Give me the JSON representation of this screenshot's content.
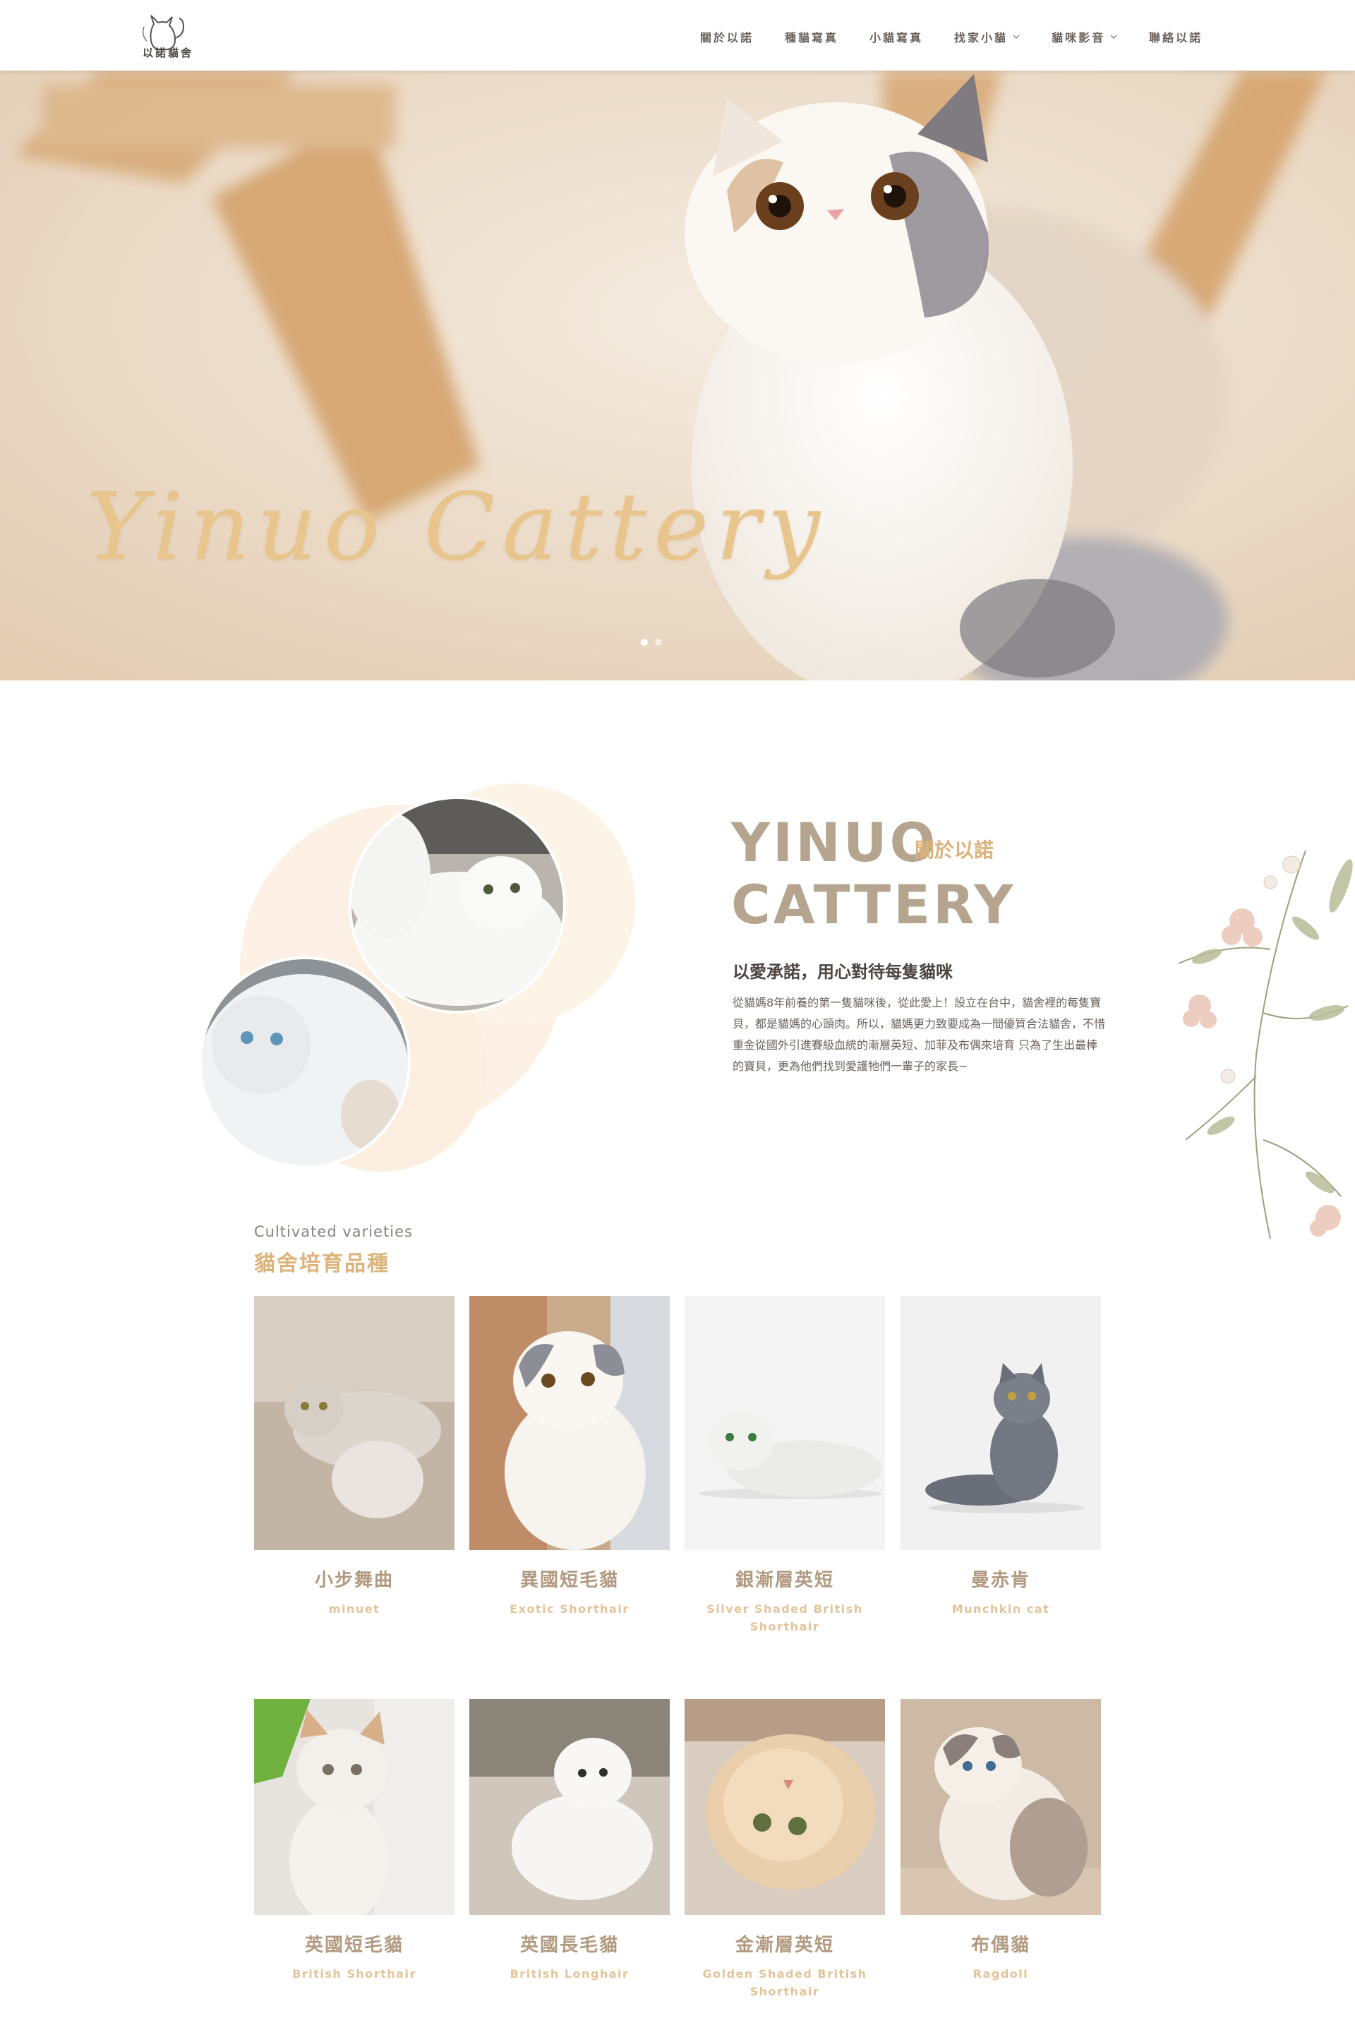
{
  "header": {
    "logo_text": "以諾貓舍",
    "nav": [
      {
        "label": "關於以諾",
        "has_dropdown": false
      },
      {
        "label": "種貓寫真",
        "has_dropdown": false
      },
      {
        "label": "小貓寫真",
        "has_dropdown": false
      },
      {
        "label": "找家小貓",
        "has_dropdown": true
      },
      {
        "label": "貓咪影音",
        "has_dropdown": true
      },
      {
        "label": "聯絡以諾",
        "has_dropdown": false
      }
    ]
  },
  "hero": {
    "title": "Yinuo Cattery",
    "slides_total": 2,
    "active_slide": 1
  },
  "about": {
    "heading_line1": "YINUO",
    "heading_line2": "CATTERY",
    "heading_zh": "關於以諾",
    "tagline": "以愛承諾，用心對待每隻貓咪",
    "body": "從貓媽8年前養的第一隻貓咪後，從此愛上！設立在台中，貓舍裡的每隻寶貝，都是貓媽的心頭肉。所以，貓媽更力致要成為一間優質合法貓舍，不惜重金從國外引進賽級血統的漸層英短、加菲及布偶來培育 只為了生出最棒的寶貝，更為他們找到愛護牠們一輩子的家長~"
  },
  "varieties": {
    "eyebrow": "Cultivated varieties",
    "title": "貓舍培育品種",
    "row1": [
      {
        "zh": "小步舞曲",
        "en": "minuet"
      },
      {
        "zh": "異國短毛貓",
        "en": "Exotic Shorthair"
      },
      {
        "zh": "銀漸層英短",
        "en": "Silver Shaded British Shorthair"
      },
      {
        "zh": "曼赤肯",
        "en": "Munchkin cat"
      }
    ],
    "row2": [
      {
        "zh": "英國短毛貓",
        "en": "British Shorthair"
      },
      {
        "zh": "英國長毛貓",
        "en": "British Longhair"
      },
      {
        "zh": "金漸層英短",
        "en": "Golden Shaded British Shorthair"
      },
      {
        "zh": "布偶貓",
        "en": "Ragdoll"
      }
    ]
  },
  "colors": {
    "accent_gold": "#dcb37a",
    "heading_taupe": "#b5a48e",
    "card_title": "#b19a7f",
    "card_subtitle": "#e3c49a"
  }
}
